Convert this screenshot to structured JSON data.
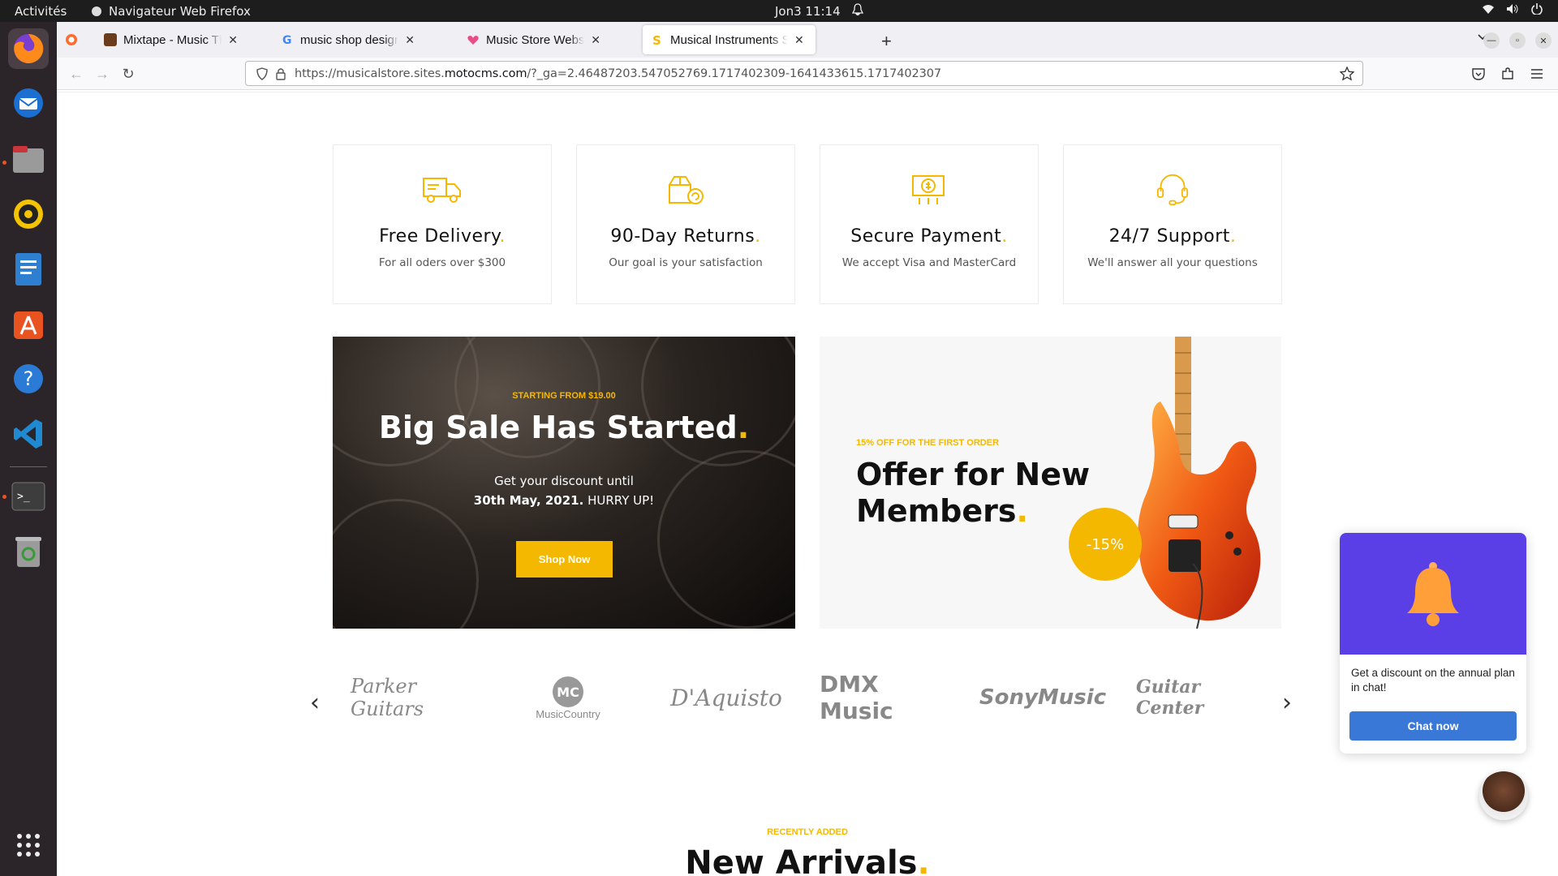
{
  "os": {
    "activities": "Activités",
    "app_name": "Navigateur Web Firefox",
    "clock": "Jon3  11:14"
  },
  "dock": {
    "items": [
      "firefox-icon",
      "thunderbird-icon",
      "files-icon",
      "rhythmbox-icon",
      "writer-icon",
      "software-icon",
      "help-icon",
      "vscode-icon",
      "terminal-icon",
      "trash-icon",
      "apps-grid-icon"
    ]
  },
  "browser": {
    "tabs": [
      {
        "label": "Mixtape - Music Theme for",
        "active": false
      },
      {
        "label": "music shop design web - G",
        "active": false
      },
      {
        "label": "Music Store Website Design",
        "active": false
      },
      {
        "label": "Musical Instruments Store",
        "active": true
      }
    ],
    "url_prefix": "https://musicalstore.sites.",
    "url_domain": "motocms.com",
    "url_suffix": "/?_ga=2.46487203.547052769.1717402309-1641433615.1717402307"
  },
  "features": [
    {
      "title": "Free Delivery",
      "desc": "For all oders over $300",
      "icon": "truck-icon"
    },
    {
      "title": "90-Day Returns",
      "desc": "Our goal is your satisfaction",
      "icon": "return-box-icon"
    },
    {
      "title": "Secure Payment",
      "desc": "We accept Visa and MasterCard",
      "icon": "payment-icon"
    },
    {
      "title": "24/7 Support",
      "desc": "We'll answer all your questions",
      "icon": "headset-icon"
    }
  ],
  "sale_banner": {
    "kicker": "STARTING FROM $19.00",
    "title": "Big Sale Has Started",
    "line1": "Get your discount until",
    "line2_bold": "30th May, 2021.",
    "line2_rest": " HURRY UP!",
    "button": "Shop Now"
  },
  "offer_banner": {
    "kicker": "15% OFF FOR THE FIRST ORDER",
    "title": "Offer for New Members",
    "badge": "-15%"
  },
  "brands": {
    "items": [
      "Parker Guitars",
      "MusicCountry",
      "D'Aquisto",
      "DMX Music",
      "SonyMusic",
      "Guitar Center"
    ],
    "prev": "‹",
    "next": "›"
  },
  "arrivals": {
    "kicker": "RECENTLY ADDED",
    "title": "New Arrivals"
  },
  "chat": {
    "message": "Get a discount on the annual plan in chat!",
    "button": "Chat now"
  },
  "colors": {
    "accent": "#f5b800",
    "chat_header": "#5b3fe6",
    "chat_button": "#3a78d8"
  }
}
